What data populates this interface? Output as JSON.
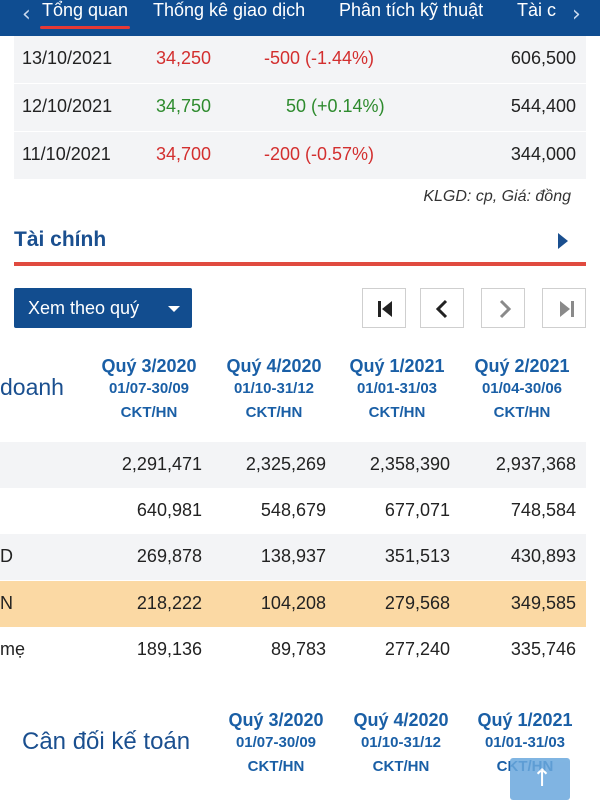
{
  "tabs": {
    "prev_icon": "chevron-left-icon",
    "next_icon": "chevron-right-icon",
    "prev_glyph": "‹",
    "next_glyph": "›",
    "items": [
      "Tổng quan",
      "Thống kê giao dịch",
      "Phân tích kỹ thuật",
      "Tài c"
    ],
    "active_index": 0
  },
  "price_history": [
    {
      "date": "13/10/2021",
      "price": "34,250",
      "change": "-500 (-1.44%)",
      "volume": "606,500",
      "direction": "down"
    },
    {
      "date": "12/10/2021",
      "price": "34,750",
      "change": "50 (+0.14%)",
      "volume": "544,400",
      "direction": "up"
    },
    {
      "date": "11/10/2021",
      "price": "34,700",
      "change": "-200 (-0.57%)",
      "volume": "344,000",
      "direction": "down"
    }
  ],
  "units_note": "KLGD: cp, Giá: đồng",
  "finance": {
    "title": "Tài chính",
    "arrow_icon": "triangle-right-icon",
    "period_select": "Xem theo quý",
    "pagination_icons": [
      "first-page-icon",
      "previous-page-icon",
      "next-page-icon",
      "last-page-icon"
    ],
    "row_label_header": "doanh",
    "columns": [
      {
        "quarter": "Quý 3/2020",
        "range": "01/07-30/09",
        "audit": "CKT/HN"
      },
      {
        "quarter": "Quý 4/2020",
        "range": "01/10-31/12",
        "audit": "CKT/HN"
      },
      {
        "quarter": "Quý 1/2021",
        "range": "01/01-31/03",
        "audit": "CKT/HN"
      },
      {
        "quarter": "Quý 2/2021",
        "range": "01/04-30/06",
        "audit": "CKT/HN"
      }
    ],
    "rows": [
      {
        "label": "",
        "values": [
          "2,291,471",
          "2,325,269",
          "2,358,390",
          "2,937,368"
        ]
      },
      {
        "label": "",
        "values": [
          "640,981",
          "548,679",
          "677,071",
          "748,584"
        ]
      },
      {
        "label": "D",
        "values": [
          "269,878",
          "138,937",
          "351,513",
          "430,893"
        ]
      },
      {
        "label": "N",
        "values": [
          "218,222",
          "104,208",
          "279,568",
          "349,585"
        ],
        "highlight": true
      },
      {
        "label": "mẹ",
        "values": [
          "189,136",
          "89,783",
          "277,240",
          "335,746"
        ]
      }
    ]
  },
  "balance_sheet": {
    "title": "Cân đối kế toán",
    "columns": [
      {
        "quarter": "Quý 3/2020",
        "range": "01/07-30/09",
        "audit": "CKT/HN"
      },
      {
        "quarter": "Quý 4/2020",
        "range": "01/10-31/12",
        "audit": "CKT/HN"
      },
      {
        "quarter": "Quý 1/2021",
        "range": "01/01-31/03",
        "audit": "CKT/HN"
      }
    ]
  },
  "scroll_top_icon": "arrow-up-icon",
  "scroll_top_glyph": "↑",
  "colors": {
    "header_bg": "#0f4d91",
    "accent_red": "#e04a3f",
    "price_down": "#d32f2f",
    "price_up": "#2e8b2e",
    "highlight_row": "#fbd9a4",
    "link_blue": "#1a5fa6"
  }
}
